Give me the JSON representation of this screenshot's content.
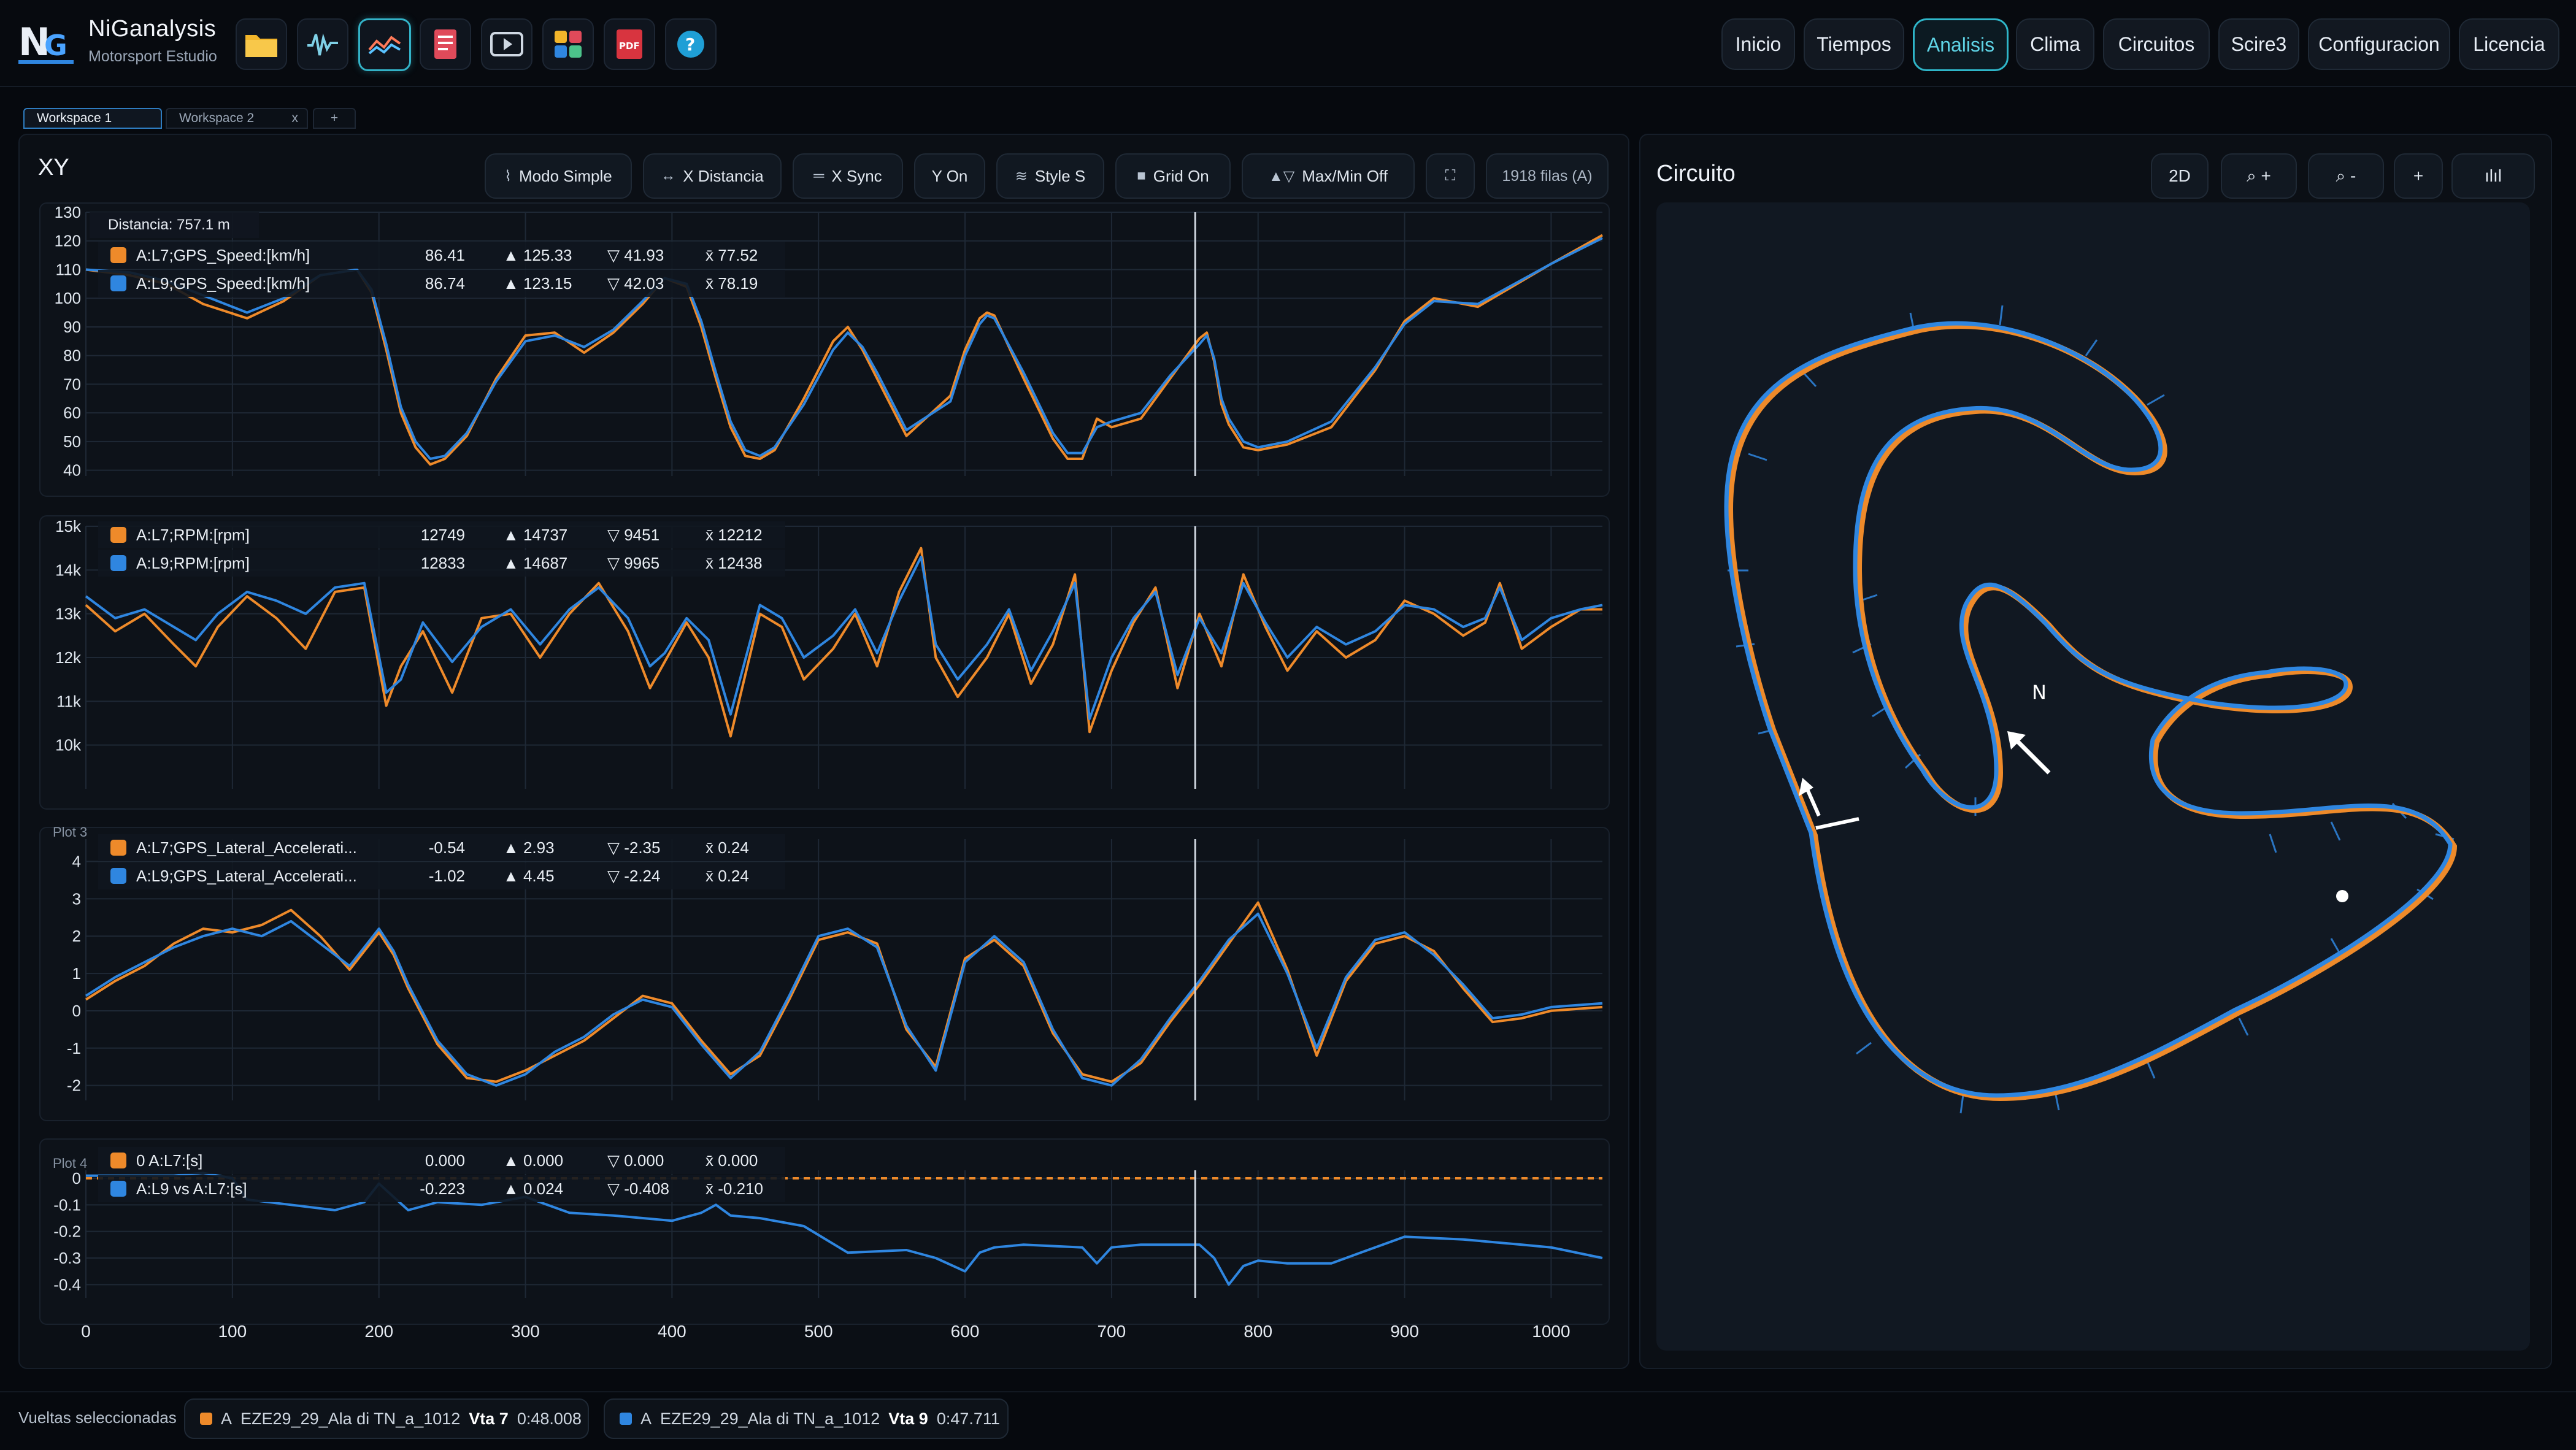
{
  "app": {
    "title": "NiGanalysis",
    "subtitle": "Motorsport Estudio"
  },
  "nav": [
    "Inicio",
    "Tiempos",
    "Analisis",
    "Clima",
    "Circuitos",
    "Scire3",
    "Configuracion",
    "Licencia"
  ],
  "nav_active": "Analisis",
  "toolbar_icons": [
    "folder-icon",
    "waveform-icon",
    "chart-lines-icon",
    "report-icon",
    "play-icon",
    "grid-apps-icon",
    "pdf-icon",
    "help-icon"
  ],
  "tabs": [
    {
      "label": "Workspace 1",
      "close": ""
    },
    {
      "label": "Workspace 2",
      "close": "x"
    },
    {
      "label": "+",
      "close": ""
    }
  ],
  "xy": {
    "title": "XY",
    "buttons": [
      {
        "glyph": "⌇",
        "label": "Modo Simple"
      },
      {
        "glyph": "↔",
        "label": "X Distancia"
      },
      {
        "glyph": "═",
        "label": "X Sync"
      },
      {
        "glyph": "",
        "label": "Y On"
      },
      {
        "glyph": "≋",
        "label": "Style S"
      },
      {
        "glyph": "■",
        "label": "Grid On"
      },
      {
        "glyph": "▲▽",
        "label": "Max/Min Off"
      },
      {
        "glyph": "⛶",
        "label": ""
      },
      {
        "glyph": "",
        "label": "1918 filas (A)"
      }
    ],
    "cursor_readout": "Distancia: 757.1 m",
    "cursor_x": 757.1
  },
  "colors": {
    "lap7": "#ee8a2a",
    "lap9": "#2f86e0",
    "accent": "#2fb6c9"
  },
  "chart_data": [
    {
      "type": "line",
      "plot_label": "",
      "x_axis": {
        "range": [
          0,
          1035
        ],
        "ticks": [
          "0",
          "100",
          "200",
          "300",
          "400",
          "500",
          "600",
          "700",
          "800",
          "900",
          "1000"
        ]
      },
      "y_ticks": [
        "130",
        "120",
        "110",
        "100",
        "90",
        "80",
        "70",
        "60",
        "50",
        "40"
      ],
      "ylim": [
        38,
        130
      ],
      "legend": [
        {
          "name": "A:L7;GPS_Speed:[km/h]",
          "value": "86.41",
          "max": "125.33",
          "min": "41.93",
          "avg": "77.52",
          "color": "#ee8a2a"
        },
        {
          "name": "A:L9;GPS_Speed:[km/h]",
          "value": "86.74",
          "max": "123.15",
          "min": "42.03",
          "avg": "78.19",
          "color": "#2f86e0"
        }
      ],
      "series": [
        {
          "x": [
            0,
            30,
            55,
            80,
            110,
            135,
            160,
            185,
            195,
            205,
            215,
            225,
            235,
            245,
            260,
            280,
            300,
            320,
            340,
            360,
            380,
            395,
            410,
            420,
            430,
            440,
            450,
            460,
            470,
            490,
            510,
            520,
            530,
            540,
            560,
            590,
            600,
            610,
            615,
            620,
            640,
            660,
            670,
            680,
            690,
            700,
            720,
            740,
            760,
            765,
            770,
            775,
            780,
            790,
            800,
            820,
            850,
            880,
            900,
            920,
            950,
            1000,
            1035
          ],
          "y": [
            110,
            108,
            105,
            98,
            93,
            99,
            108,
            110,
            102,
            82,
            60,
            48,
            42,
            44,
            52,
            72,
            87,
            88,
            81,
            88,
            98,
            107,
            104,
            90,
            72,
            55,
            45,
            44,
            47,
            65,
            85,
            90,
            82,
            72,
            52,
            66,
            82,
            93,
            95,
            94,
            72,
            51,
            44,
            44,
            58,
            55,
            58,
            72,
            86,
            88,
            78,
            63,
            56,
            48,
            47,
            49,
            55,
            75,
            92,
            100,
            97,
            112,
            122
          ]
        },
        {
          "x": [
            0,
            30,
            55,
            80,
            110,
            135,
            160,
            185,
            195,
            205,
            215,
            225,
            235,
            245,
            260,
            280,
            300,
            320,
            340,
            360,
            380,
            395,
            410,
            420,
            430,
            440,
            450,
            460,
            470,
            490,
            510,
            520,
            530,
            540,
            560,
            590,
            600,
            610,
            615,
            620,
            640,
            660,
            670,
            680,
            690,
            700,
            720,
            740,
            760,
            765,
            770,
            775,
            780,
            790,
            800,
            820,
            850,
            880,
            900,
            920,
            950,
            1000,
            1035
          ],
          "y": [
            110,
            109,
            106,
            101,
            95,
            100,
            108,
            110,
            103,
            84,
            62,
            50,
            44,
            45,
            53,
            71,
            85,
            87,
            83,
            89,
            99,
            107,
            105,
            92,
            74,
            57,
            47,
            45,
            48,
            63,
            82,
            88,
            83,
            74,
            54,
            64,
            80,
            91,
            94,
            93,
            74,
            53,
            46,
            46,
            55,
            57,
            60,
            73,
            84,
            87,
            79,
            65,
            58,
            50,
            48,
            50,
            57,
            76,
            91,
            99,
            98,
            112,
            121
          ]
        }
      ]
    },
    {
      "type": "line",
      "plot_label": "",
      "x_axis": {
        "range": [
          0,
          1035
        ]
      },
      "y_ticks": [
        "15k",
        "14k",
        "13k",
        "12k",
        "11k",
        "10k"
      ],
      "ylim": [
        9000,
        15000
      ],
      "legend": [
        {
          "name": "A:L7;RPM:[rpm]",
          "value": "12749",
          "max": "14737",
          "min": "9451",
          "avg": "12212",
          "color": "#ee8a2a"
        },
        {
          "name": "A:L9;RPM:[rpm]",
          "value": "12833",
          "max": "14687",
          "min": "9965",
          "avg": "12438",
          "color": "#2f86e0"
        }
      ],
      "series": [
        {
          "x": [
            0,
            20,
            40,
            60,
            75,
            90,
            110,
            130,
            150,
            170,
            190,
            205,
            215,
            230,
            250,
            270,
            290,
            310,
            330,
            350,
            370,
            385,
            395,
            410,
            425,
            440,
            460,
            475,
            490,
            510,
            525,
            540,
            555,
            570,
            580,
            595,
            615,
            630,
            645,
            660,
            675,
            685,
            700,
            715,
            730,
            745,
            760,
            775,
            790,
            805,
            820,
            840,
            860,
            880,
            900,
            920,
            940,
            955,
            965,
            980,
            1000,
            1020,
            1035
          ],
          "y": [
            13200,
            12600,
            13000,
            12300,
            11800,
            12700,
            13400,
            12900,
            12200,
            13500,
            13600,
            10900,
            11800,
            12600,
            11200,
            12900,
            13000,
            12000,
            13000,
            13700,
            12600,
            11300,
            11900,
            12800,
            12000,
            10200,
            13000,
            12700,
            11500,
            12200,
            13000,
            11800,
            13500,
            14500,
            12000,
            11100,
            12000,
            13000,
            11400,
            12300,
            13900,
            10300,
            11700,
            12800,
            13600,
            11300,
            13000,
            11800,
            13900,
            12700,
            11700,
            12600,
            12000,
            12400,
            13300,
            13000,
            12500,
            12800,
            13700,
            12200,
            12700,
            13100,
            13100
          ]
        },
        {
          "x": [
            0,
            20,
            40,
            60,
            75,
            90,
            110,
            130,
            150,
            170,
            190,
            205,
            215,
            230,
            250,
            270,
            290,
            310,
            330,
            350,
            370,
            385,
            395,
            410,
            425,
            440,
            460,
            475,
            490,
            510,
            525,
            540,
            555,
            570,
            580,
            595,
            615,
            630,
            645,
            660,
            675,
            685,
            700,
            715,
            730,
            745,
            760,
            775,
            790,
            805,
            820,
            840,
            860,
            880,
            900,
            920,
            940,
            955,
            965,
            980,
            1000,
            1020,
            1035
          ],
          "y": [
            13400,
            12900,
            13100,
            12700,
            12400,
            13000,
            13500,
            13300,
            13000,
            13600,
            13700,
            11200,
            11500,
            12800,
            11900,
            12700,
            13100,
            12300,
            13100,
            13600,
            12900,
            11800,
            12100,
            12900,
            12400,
            10700,
            13200,
            12900,
            12000,
            12500,
            13100,
            12100,
            13300,
            14300,
            12300,
            11500,
            12300,
            13100,
            11700,
            12600,
            13700,
            10600,
            12000,
            12900,
            13500,
            11600,
            12900,
            12100,
            13700,
            12800,
            12000,
            12700,
            12300,
            12600,
            13200,
            13100,
            12700,
            12900,
            13600,
            12400,
            12900,
            13100,
            13200
          ]
        }
      ]
    },
    {
      "type": "line",
      "plot_label": "Plot 3",
      "x_axis": {
        "range": [
          0,
          1035
        ]
      },
      "y_ticks": [
        "4",
        "3",
        "2",
        "1",
        "0",
        "-1",
        "-2"
      ],
      "ylim": [
        -2.4,
        4.6
      ],
      "legend": [
        {
          "name": "A:L7;GPS_Lateral_Accelerati...",
          "value": "-0.54",
          "max": "2.93",
          "min": "-2.35",
          "avg": "0.24",
          "color": "#ee8a2a"
        },
        {
          "name": "A:L9;GPS_Lateral_Accelerati...",
          "value": "-1.02",
          "max": "4.45",
          "min": "-2.24",
          "avg": "0.24",
          "color": "#2f86e0"
        }
      ],
      "series": [
        {
          "x": [
            0,
            20,
            40,
            60,
            80,
            100,
            120,
            140,
            160,
            180,
            200,
            210,
            220,
            240,
            260,
            280,
            300,
            320,
            340,
            360,
            380,
            400,
            420,
            440,
            460,
            480,
            500,
            520,
            540,
            560,
            580,
            600,
            620,
            640,
            660,
            680,
            700,
            720,
            740,
            760,
            780,
            800,
            820,
            840,
            860,
            880,
            900,
            920,
            940,
            960,
            980,
            1000,
            1035
          ],
          "y": [
            0.3,
            0.8,
            1.2,
            1.8,
            2.2,
            2.1,
            2.3,
            2.7,
            2.0,
            1.1,
            2.1,
            1.5,
            0.6,
            -0.9,
            -1.8,
            -1.9,
            -1.6,
            -1.2,
            -0.8,
            -0.2,
            0.4,
            0.2,
            -0.8,
            -1.7,
            -1.2,
            0.3,
            1.9,
            2.1,
            1.8,
            -0.5,
            -1.5,
            1.4,
            1.9,
            1.2,
            -0.6,
            -1.7,
            -1.9,
            -1.4,
            -0.3,
            0.7,
            1.8,
            2.9,
            1.1,
            -1.2,
            0.8,
            1.8,
            2.0,
            1.6,
            0.6,
            -0.3,
            -0.2,
            0.0,
            0.1
          ]
        },
        {
          "x": [
            0,
            20,
            40,
            60,
            80,
            100,
            120,
            140,
            160,
            180,
            200,
            210,
            220,
            240,
            260,
            280,
            300,
            320,
            340,
            360,
            380,
            400,
            420,
            440,
            460,
            480,
            500,
            520,
            540,
            560,
            580,
            600,
            620,
            640,
            660,
            680,
            700,
            720,
            740,
            760,
            780,
            800,
            820,
            840,
            860,
            880,
            900,
            920,
            940,
            960,
            980,
            1000,
            1035
          ],
          "y": [
            0.4,
            0.9,
            1.3,
            1.7,
            2.0,
            2.2,
            2.0,
            2.4,
            1.8,
            1.2,
            2.2,
            1.6,
            0.7,
            -0.8,
            -1.7,
            -2.0,
            -1.7,
            -1.1,
            -0.7,
            -0.1,
            0.3,
            0.1,
            -0.9,
            -1.8,
            -1.1,
            0.4,
            2.0,
            2.2,
            1.7,
            -0.4,
            -1.6,
            1.3,
            2.0,
            1.3,
            -0.5,
            -1.8,
            -2.0,
            -1.3,
            -0.2,
            0.8,
            1.9,
            2.6,
            1.0,
            -1.0,
            0.9,
            1.9,
            2.1,
            1.5,
            0.7,
            -0.2,
            -0.1,
            0.1,
            0.2
          ]
        }
      ]
    },
    {
      "type": "line",
      "plot_label": "Plot 4",
      "x_axis": {
        "range": [
          0,
          1035
        ]
      },
      "y_ticks": [
        "0",
        "-0.1",
        "-0.2",
        "-0.3",
        "-0.4"
      ],
      "ylim": [
        -0.45,
        0.03
      ],
      "legend": [
        {
          "name": "0 A:L7:[s]",
          "value": "0.000",
          "max": "0.000",
          "min": "0.000",
          "avg": "0.000",
          "color": "#ee8a2a"
        },
        {
          "name": "A:L9 vs A:L7:[s]",
          "value": "-0.223",
          "max": "0.024",
          "min": "-0.408",
          "avg": "-0.210",
          "color": "#2f86e0"
        }
      ],
      "series": [
        {
          "x": [
            0,
            1035
          ],
          "y": [
            0,
            0
          ]
        },
        {
          "x": [
            0,
            60,
            80,
            100,
            110,
            140,
            170,
            190,
            200,
            220,
            240,
            270,
            300,
            330,
            360,
            400,
            420,
            430,
            440,
            460,
            490,
            520,
            560,
            580,
            600,
            610,
            620,
            640,
            680,
            690,
            700,
            720,
            760,
            770,
            780,
            790,
            800,
            820,
            850,
            870,
            900,
            940,
            980,
            1000,
            1035
          ],
          "y": [
            0.01,
            0.01,
            0.02,
            0.0,
            -0.08,
            -0.1,
            -0.12,
            -0.09,
            -0.02,
            -0.12,
            -0.09,
            -0.1,
            -0.07,
            -0.13,
            -0.14,
            -0.16,
            -0.13,
            -0.1,
            -0.14,
            -0.15,
            -0.18,
            -0.28,
            -0.27,
            -0.3,
            -0.35,
            -0.28,
            -0.26,
            -0.25,
            -0.26,
            -0.32,
            -0.26,
            -0.25,
            -0.25,
            -0.3,
            -0.4,
            -0.33,
            -0.31,
            -0.32,
            -0.32,
            -0.28,
            -0.22,
            -0.23,
            -0.25,
            -0.26,
            -0.3
          ]
        }
      ]
    }
  ],
  "circuit": {
    "title": "Circuito",
    "buttons": [
      "2D",
      "⌕ +",
      "⌕ -",
      "+",
      "ılıl"
    ],
    "north_label": "N"
  },
  "status": {
    "label": "Vueltas seleccionadas",
    "laps": [
      {
        "prefix": "A",
        "session": "EZE29_29_Ala di TN_a_1012",
        "lap": "Vta 7",
        "time": "0:48.008",
        "color": "#ee8a2a"
      },
      {
        "prefix": "A",
        "session": "EZE29_29_Ala di TN_a_1012",
        "lap": "Vta 9",
        "time": "0:47.711",
        "color": "#2f86e0"
      }
    ]
  }
}
